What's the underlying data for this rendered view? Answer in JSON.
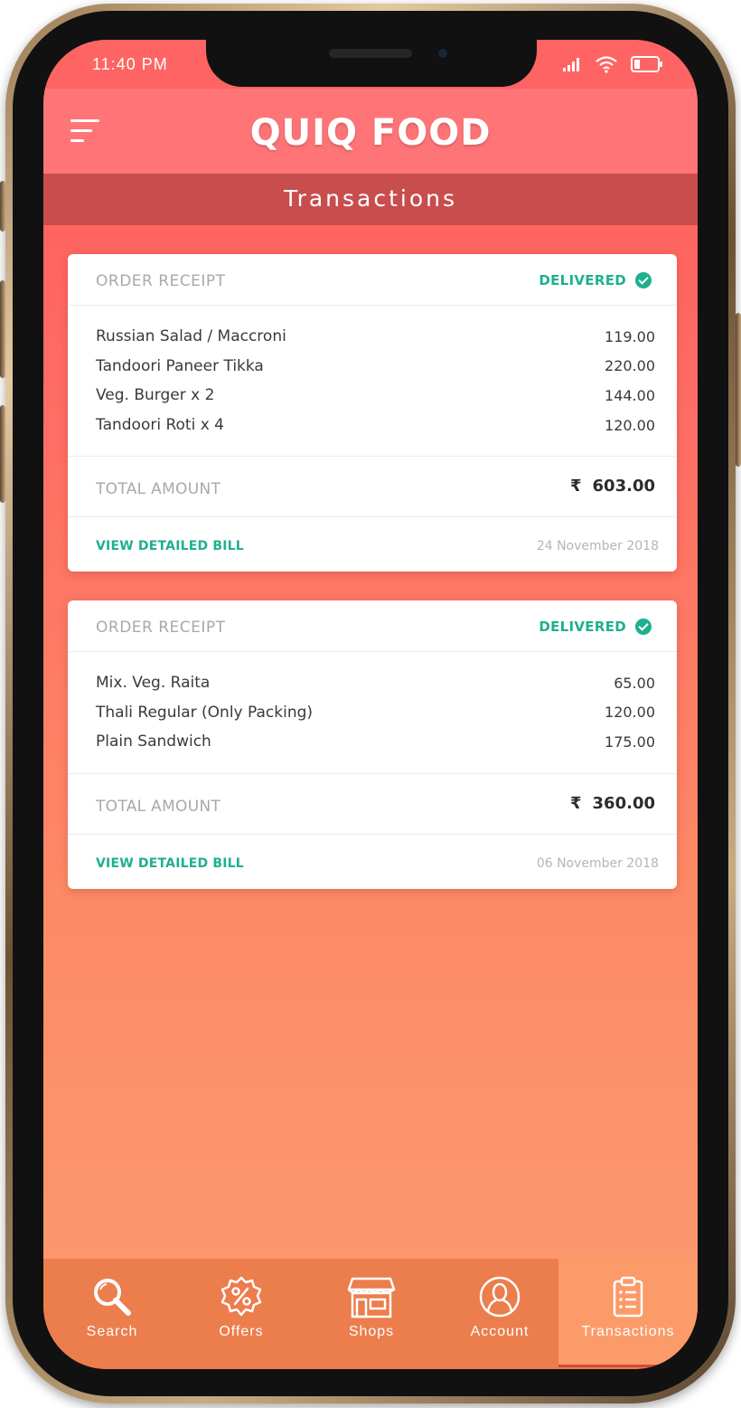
{
  "status_bar": {
    "time": "11:40 PM"
  },
  "header": {
    "app_title": "QUIQ FOOD",
    "page_title": "Transactions"
  },
  "orders": [
    {
      "label": "ORDER RECEIPT",
      "status": "DELIVERED",
      "items": [
        {
          "name": "Russian Salad / Maccroni",
          "price": "119.00"
        },
        {
          "name": "Tandoori Paneer Tikka",
          "price": "220.00"
        },
        {
          "name": "Veg. Burger x 2",
          "price": "144.00"
        },
        {
          "name": "Tandoori Roti x 4",
          "price": "120.00"
        }
      ],
      "total_label": "TOTAL AMOUNT",
      "currency": "₹",
      "total": "603.00",
      "action": "VIEW DETAILED BILL",
      "date": "24 November 2018"
    },
    {
      "label": "ORDER RECEIPT",
      "status": "DELIVERED",
      "items": [
        {
          "name": "Mix. Veg. Raita",
          "price": "65.00"
        },
        {
          "name": "Thali Regular (Only Packing)",
          "price": "120.00"
        },
        {
          "name": "Plain Sandwich",
          "price": "175.00"
        }
      ],
      "total_label": "TOTAL AMOUNT",
      "currency": "₹",
      "total": "360.00",
      "action": "VIEW DETAILED BILL",
      "date": "06 November 2018"
    }
  ],
  "nav": {
    "items": [
      {
        "label": "Search",
        "icon": "search-icon",
        "active": false
      },
      {
        "label": "Offers",
        "icon": "offer-badge-icon",
        "active": false
      },
      {
        "label": "Shops",
        "icon": "shop-icon",
        "active": false
      },
      {
        "label": "Account",
        "icon": "user-icon",
        "active": false
      },
      {
        "label": "Transactions",
        "icon": "clipboard-list-icon",
        "active": true
      }
    ]
  },
  "colors": {
    "header": "#ff7577",
    "page_bar": "#c84d4d",
    "accent_green": "#1eb08e",
    "nav_bg": "#ec7d4d",
    "nav_active_bg": "#fb9b69"
  }
}
